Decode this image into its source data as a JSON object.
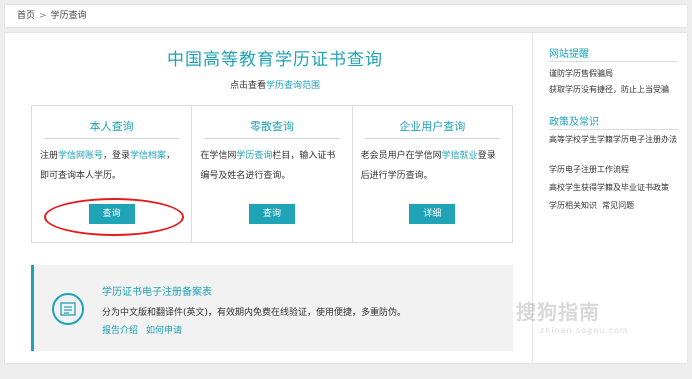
{
  "breadcrumb": {
    "home": "首页",
    "separator": ">",
    "current": "学历查询"
  },
  "main": {
    "title": "中国高等教育学历证书查询",
    "subtitle_prefix": "点击查看",
    "subtitle_link": "学历查询范围"
  },
  "cards": [
    {
      "title": "本人查询",
      "desc": [
        "注册",
        "学信网账号",
        "，登录",
        "学信档案",
        "，即可查询本人学历。"
      ],
      "button": "查询"
    },
    {
      "title": "零散查询",
      "desc": [
        "在学信网",
        "学历查询",
        "栏目，输入证书编号及姓名进行查询。"
      ],
      "button": "查询"
    },
    {
      "title": "企业用户查询",
      "desc": [
        "老会员用户在学信网",
        "学信就业",
        "登录后进行学历查询。"
      ],
      "button": "详细"
    }
  ],
  "register": {
    "title": "学历证书电子注册备案表",
    "desc": "分为中文版和翻译件(英文)，有效期内免费在线验证，使用便捷，多重防伪。",
    "link1": "报告介绍",
    "link2": "如何申请"
  },
  "side": {
    "section1_title": "网站提醒",
    "section1_items": [
      "谨防学历售假骗局",
      "获取学历没有捷径，防止上当受骗"
    ],
    "section2_title": "政策及常识",
    "section2_items": [
      "高等学校学生学籍学历电子注册办法",
      "学历电子注册工作流程",
      "高校学生获得学籍及毕业证书政策",
      "学历相关知识",
      "常见问题"
    ]
  },
  "watermark": {
    "text": "搜狗指南",
    "url": "zhinan.sogou.com"
  },
  "colors": {
    "accent": "#1fa3b7",
    "highlight": "#e31b1b"
  }
}
